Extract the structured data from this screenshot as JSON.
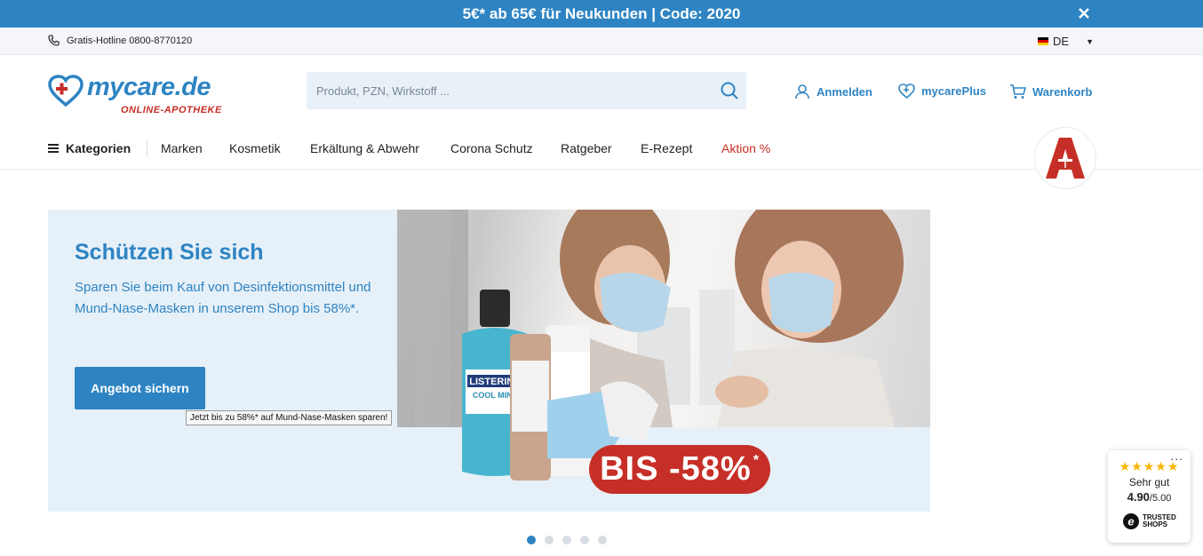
{
  "promo": {
    "text": "5€* ab 65€ für Neukunden | Code: 2020",
    "close_icon": "close-icon"
  },
  "utility": {
    "hotline": "Gratis-Hotline 0800-8770120",
    "language": "DE"
  },
  "header": {
    "logo_word": "mycare.de",
    "logo_sub": "ONLINE-APOTHEKE",
    "search_placeholder": "Produkt, PZN, Wirkstoff ...",
    "login": "Anmelden",
    "plus": "mycarePlus",
    "cart": "Warenkorb"
  },
  "nav": {
    "categories": "Kategorien",
    "items": [
      "Marken",
      "Kosmetik",
      "Erkältung & Abwehr",
      "Corona Schutz",
      "Ratgeber",
      "E-Rezept",
      "Aktion %"
    ]
  },
  "hero": {
    "title": "Schützen Sie sich",
    "description": "Sparen Sie beim Kauf von Desinfektionsmittel und Mund-Nase-Masken in unserem Shop bis 58%*.",
    "cta": "Angebot sichern",
    "badge": "BIS -58%",
    "badge_sup": "*",
    "tooltip": "Jetzt bis zu 58%* auf Mund-Nase-Masken sparen!"
  },
  "carousel": {
    "slides": 5,
    "active_index": 0
  },
  "trusted_shops": {
    "more": "...",
    "stars": "★★★★★",
    "label": "Sehr gut",
    "score": "4.90",
    "max": "/5.00",
    "logo_text_1": "TRUSTED",
    "logo_text_2": "SHOPS"
  },
  "colors": {
    "primary": "#2e84c3",
    "accent_red": "#c62f27",
    "hero_bg": "#e6f0f8"
  }
}
